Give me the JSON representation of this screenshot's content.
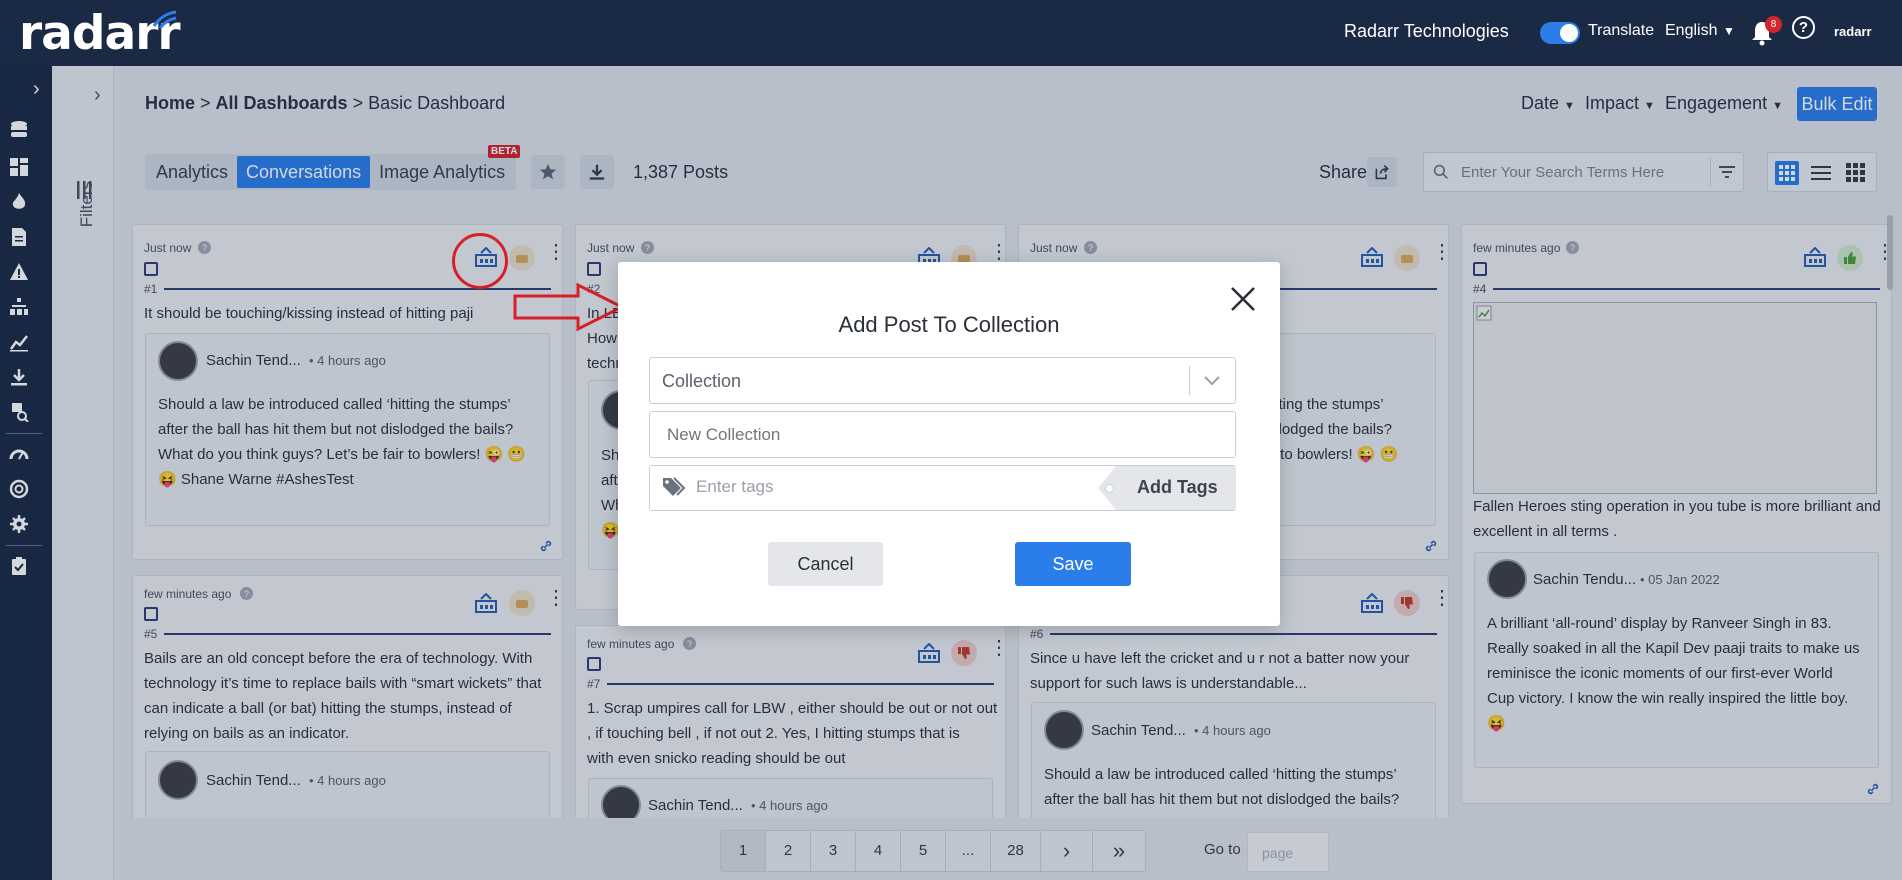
{
  "app": {
    "logo": "radarr",
    "company": "Radarr Technologies",
    "translate_label": "Translate",
    "language": "English",
    "notif_count": "8",
    "help": "?",
    "brand_small": "radarr"
  },
  "sidebar": {
    "filters_label": "Filters"
  },
  "breadcrumb": {
    "home": "Home",
    "sep1": " > ",
    "dashboards": "All Dashboards",
    "sep2": " > ",
    "current": "Basic Dashboard"
  },
  "filters_bar": {
    "date": "Date",
    "impact": "Impact",
    "engagement": "Engagement",
    "bulk_edit": "Bulk Edit"
  },
  "tabs": [
    {
      "label": "Analytics"
    },
    {
      "label": "Conversations"
    },
    {
      "label": "Image Analytics"
    }
  ],
  "beta": "BETA",
  "post_count": "1,387 Posts",
  "share": "Share",
  "search": {
    "placeholder": "Enter Your Search Terms Here"
  },
  "cards": [
    {
      "time": "Just now",
      "num": "#1",
      "text": "It should be touching/kissing instead of hitting paji",
      "user": "Sachin Tend...",
      "utime": "• 4 hours ago",
      "inner_lines": [
        "Should a law be introduced called ‘hitting the stumps’",
        "after the ball has hit them but not dislodged the bails?",
        "What do you think guys? Let’s be fair to bowlers! 😜 😬",
        "😝 Shane Warne #AshesTest"
      ]
    },
    {
      "time": "Just now",
      "num": "#2",
      "l1": "In LB",
      "l2": "How",
      "l3": "techn",
      "i1": "Sh",
      "i2": "aft",
      "i3": "Wh",
      "i4": "😝"
    },
    {
      "time": "Just now",
      "i1": "itting the stumps’",
      "i2": "slodged the bails?",
      "i3": "r to bowlers! 😜 😬"
    },
    {
      "time": "few minutes ago",
      "num": "#4",
      "lines": [
        "Fallen Heroes sting operation in you tube is more brilliant and",
        "excellent in all terms ."
      ],
      "user": "Sachin Tendu...",
      "utime": "• 05 Jan 2022",
      "inner_lines": [
        "A brilliant ‘all-round’ display by Ranveer Singh in 83.",
        "Really soaked in all the Kapil Dev paaji traits to make us",
        "reminisce the iconic moments of our first-ever World",
        "Cup victory. I know the win really inspired the little boy.",
        "😝"
      ]
    },
    {
      "time": "few minutes ago",
      "num": "#5",
      "lines": [
        "Bails are an old concept before the era of technology. With",
        "technology it’s time to replace bails with “smart wickets” that",
        "can indicate a ball (or bat) hitting the stumps, instead of",
        "relying on bails as an indicator."
      ],
      "user": "Sachin Tend...",
      "utime": "• 4 hours ago"
    },
    {
      "num": "#6",
      "lines": [
        "Since u have left the cricket and u r not a batter now your",
        "support for such laws is understandable..."
      ],
      "user": "Sachin Tend...",
      "utime": "• 4 hours ago",
      "inner_lines": [
        "Should a law be introduced called ‘hitting the stumps’",
        "after the ball has hit them but not dislodged the bails?"
      ]
    },
    {
      "time": "few minutes ago",
      "num": "#7",
      "lines": [
        "1. Scrap umpires call for LBW , either should be out or not out",
        ", if touching bell , if not out 2. Yes, I hitting stumps that is",
        "with even snicko reading should be out"
      ],
      "user": "Sachin Tend...",
      "utime": "• 4 hours ago"
    }
  ],
  "pagination": {
    "pages": [
      "1",
      "2",
      "3",
      "4",
      "5",
      "...",
      "28"
    ],
    "next": "›",
    "last": "»",
    "goto_label": "Go to",
    "goto_placeholder": "page"
  },
  "modal": {
    "title": "Add Post To Collection",
    "collection_placeholder": "Collection",
    "new_collection_placeholder": "New Collection",
    "tags_placeholder": "Enter tags",
    "add_tags": "Add Tags",
    "cancel": "Cancel",
    "save": "Save"
  },
  "colors": {
    "accent": "#2b7de9",
    "navy": "#1b2a44",
    "annotation": "#d61f26"
  }
}
